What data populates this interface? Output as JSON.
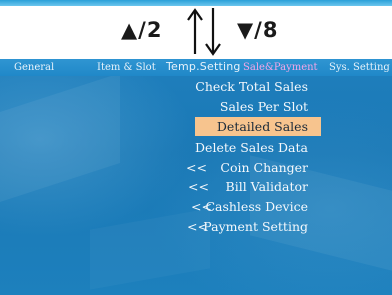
{
  "legend": {
    "up_key": "▲/2",
    "down_key": "▼/8"
  },
  "tabs": [
    {
      "label": "General"
    },
    {
      "label": "Item & Slot"
    },
    {
      "label": "Temp.Setting"
    },
    {
      "label": "Sale&Payment",
      "active": true
    },
    {
      "label": "Sys. Setting"
    }
  ],
  "menu": {
    "items": [
      {
        "label": "Check Total Sales",
        "submenu": false
      },
      {
        "label": "Sales Per Slot",
        "submenu": false
      },
      {
        "label": "Detailed Sales",
        "submenu": false,
        "selected": true
      },
      {
        "label": "Delete Sales Data",
        "submenu": false
      },
      {
        "label": "Coin Changer",
        "submenu": true,
        "marker": "<<"
      },
      {
        "label": "Bill Validator",
        "submenu": true,
        "marker": "<<"
      },
      {
        "label": "Cashless Device",
        "submenu": true,
        "marker": "<<"
      },
      {
        "label": "Payment Setting",
        "submenu": true,
        "marker": "<<"
      }
    ]
  },
  "colors": {
    "screen": "#1d7fbd",
    "highlight": "#f7c48e",
    "active_tab": "#f3a6e6",
    "text": "#f4f8fc"
  }
}
